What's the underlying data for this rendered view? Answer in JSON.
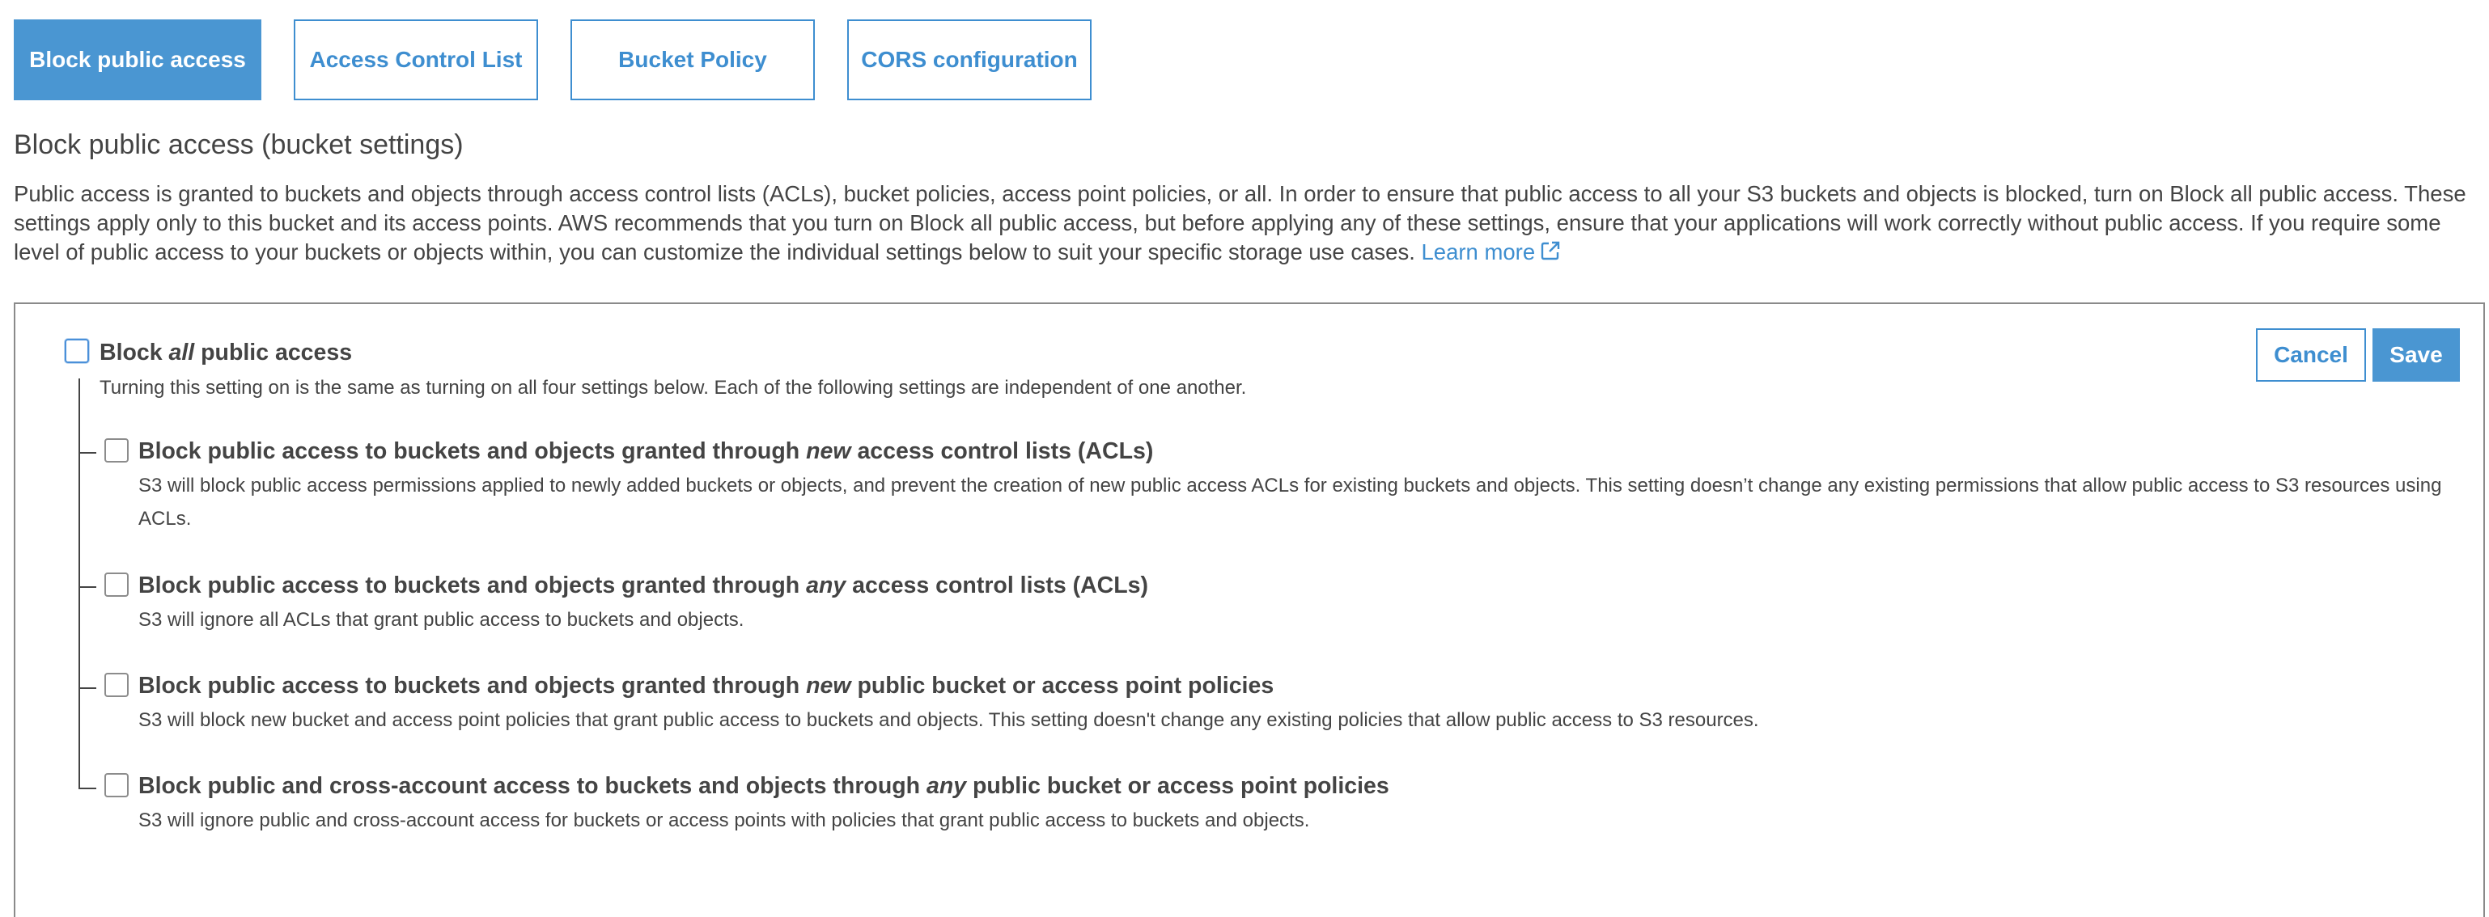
{
  "tabs": [
    {
      "label": "Block public access",
      "active": true
    },
    {
      "label": "Access Control List",
      "active": false
    },
    {
      "label": "Bucket Policy",
      "active": false
    },
    {
      "label": "CORS configuration",
      "active": false
    }
  ],
  "section": {
    "title": "Block public access (bucket settings)",
    "description": "Public access is granted to buckets and objects through access control lists (ACLs), bucket policies, access point policies, or all. In order to ensure that public access to all your S3 buckets and objects is blocked, turn on Block all public access. These settings apply only to this bucket and its access points. AWS recommends that you turn on Block all public access, but before applying any of these settings, ensure that your applications will work correctly without public access. If you require some level of public access to your buckets or objects within, you can customize the individual settings below to suit your specific storage use cases.",
    "learn_more": "Learn more"
  },
  "buttons": {
    "cancel": "Cancel",
    "save": "Save"
  },
  "master": {
    "title_pre": "Block ",
    "title_em": "all",
    "title_post": " public access",
    "description": "Turning this setting on is the same as turning on all four settings below. Each of the following settings are independent of one another.",
    "checked": false
  },
  "options": [
    {
      "title_pre": "Block public access to buckets and objects granted through ",
      "title_em": "new",
      "title_post": " access control lists (ACLs)",
      "description": "S3 will block public access permissions applied to newly added buckets or objects, and prevent the creation of new public access ACLs for existing buckets and objects. This setting doesn’t change any existing permissions that allow public access to S3 resources using ACLs.",
      "checked": false
    },
    {
      "title_pre": "Block public access to buckets and objects granted through ",
      "title_em": "any",
      "title_post": " access control lists (ACLs)",
      "description": "S3 will ignore all ACLs that grant public access to buckets and objects.",
      "checked": false
    },
    {
      "title_pre": "Block public access to buckets and objects granted through ",
      "title_em": "new",
      "title_post": " public bucket or access point policies",
      "description": "S3 will block new bucket and access point policies that grant public access to buckets and objects. This setting doesn't change any existing policies that allow public access to S3 resources.",
      "checked": false
    },
    {
      "title_pre": "Block public and cross-account access to buckets and objects through ",
      "title_em": "any",
      "title_post": " public bucket or access point policies",
      "description": "S3 will ignore public and cross-account access for buckets or access points with policies that grant public access to buckets and objects.",
      "checked": false
    }
  ],
  "colors": {
    "accent": "#4a96d2",
    "link": "#3e8ed0",
    "text": "#444444",
    "border": "#8a8a8a"
  },
  "icons": {
    "external_link": "external-link-icon"
  }
}
